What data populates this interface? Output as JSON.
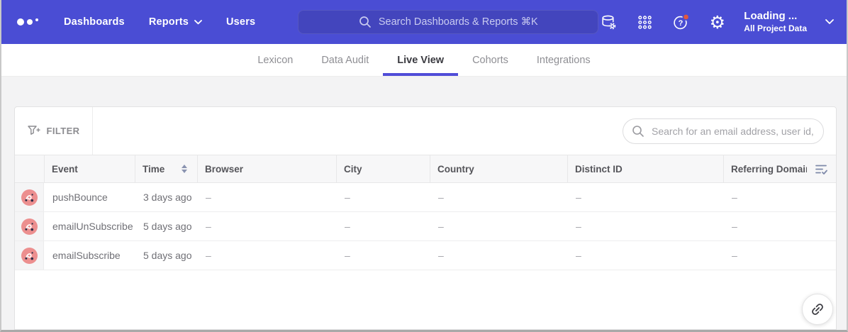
{
  "navbar": {
    "items": [
      {
        "label": "Dashboards"
      },
      {
        "label": "Reports"
      },
      {
        "label": "Users"
      }
    ],
    "search_placeholder": "Search Dashboards & Reports ⌘K",
    "project": {
      "title": "Loading ...",
      "subtitle": "All Project Data"
    }
  },
  "tabs": [
    {
      "label": "Lexicon"
    },
    {
      "label": "Data Audit"
    },
    {
      "label": "Live View",
      "active": true
    },
    {
      "label": "Cohorts"
    },
    {
      "label": "Integrations"
    }
  ],
  "toolbar": {
    "filter_label": "FILTER",
    "search_placeholder": "Search for an email address, user id, etc."
  },
  "table": {
    "columns": [
      "Event",
      "Time",
      "Browser",
      "City",
      "Country",
      "Distinct ID",
      "Referring Domain"
    ],
    "rows": [
      {
        "event": "pushBounce",
        "time": "3 days ago",
        "browser": "–",
        "city": "–",
        "country": "–",
        "distinct_id": "–",
        "referring_domain": "–"
      },
      {
        "event": "emailUnSubscribe",
        "time": "5 days ago",
        "browser": "–",
        "city": "–",
        "country": "–",
        "distinct_id": "–",
        "referring_domain": "–"
      },
      {
        "event": "emailSubscribe",
        "time": "5 days ago",
        "browser": "–",
        "city": "–",
        "country": "–",
        "distinct_id": "–",
        "referring_domain": "–"
      }
    ]
  },
  "icons": {
    "logo": "mixpanel-three-dots",
    "nav_search": "magnifier",
    "data_management": "database-with-gear",
    "apps": "grid-of-dots",
    "help": "question-mark-circle-with-badge",
    "settings": "gear",
    "filter": "funnel-plus",
    "sort": "up-down-triangles",
    "column_settings": "list-with-check",
    "row_avatar": "pink-event-avatar",
    "share": "chain-link"
  },
  "colors": {
    "navbar_bg": "#4A4DD4",
    "navbar_search_bg": "#4345BD",
    "tab_active_underline": "#504DD8",
    "help_badge": "#E2583E",
    "avatar_bg": "#EC8F8F",
    "page_bg": "#F3F3F4",
    "header_bg": "#F7F7F8"
  }
}
